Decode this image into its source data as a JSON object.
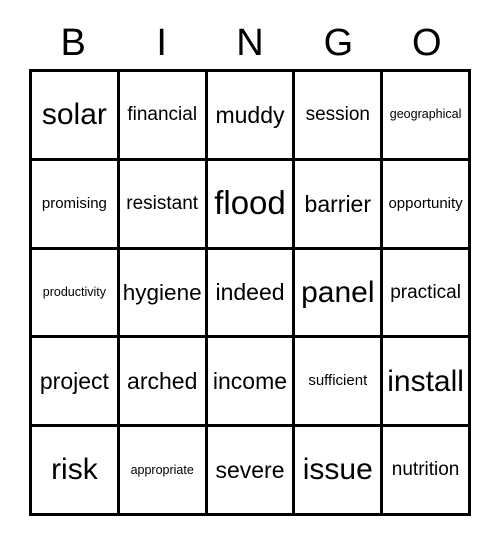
{
  "card": {
    "title_letters": [
      "B",
      "I",
      "N",
      "G",
      "O"
    ],
    "grid_line_color": "#000000",
    "background_color": "#ffffff",
    "text_color": "#000000",
    "columns": 5,
    "rows": 5,
    "cells": [
      [
        {
          "word": "solar",
          "size": "lg"
        },
        {
          "word": "financial",
          "size": "sm"
        },
        {
          "word": "muddy",
          "size": "md"
        },
        {
          "word": "session",
          "size": "sm"
        },
        {
          "word": "geographical",
          "size": "xxs"
        }
      ],
      [
        {
          "word": "promising",
          "size": "xs"
        },
        {
          "word": "resistant",
          "size": "sm"
        },
        {
          "word": "flood",
          "size": "xl"
        },
        {
          "word": "barrier",
          "size": "md"
        },
        {
          "word": "opportunity",
          "size": "xs"
        }
      ],
      [
        {
          "word": "productivity",
          "size": "xxs"
        },
        {
          "word": "hygiene",
          "size": "md"
        },
        {
          "word": "indeed",
          "size": "md"
        },
        {
          "word": "panel",
          "size": "lg"
        },
        {
          "word": "practical",
          "size": "sm"
        }
      ],
      [
        {
          "word": "project",
          "size": "md"
        },
        {
          "word": "arched",
          "size": "md"
        },
        {
          "word": "income",
          "size": "md"
        },
        {
          "word": "sufficient",
          "size": "xs"
        },
        {
          "word": "install",
          "size": "lg"
        }
      ],
      [
        {
          "word": "risk",
          "size": "lg"
        },
        {
          "word": "appropriate",
          "size": "xxs"
        },
        {
          "word": "severe",
          "size": "md"
        },
        {
          "word": "issue",
          "size": "lg"
        },
        {
          "word": "nutrition",
          "size": "sm"
        }
      ]
    ]
  }
}
